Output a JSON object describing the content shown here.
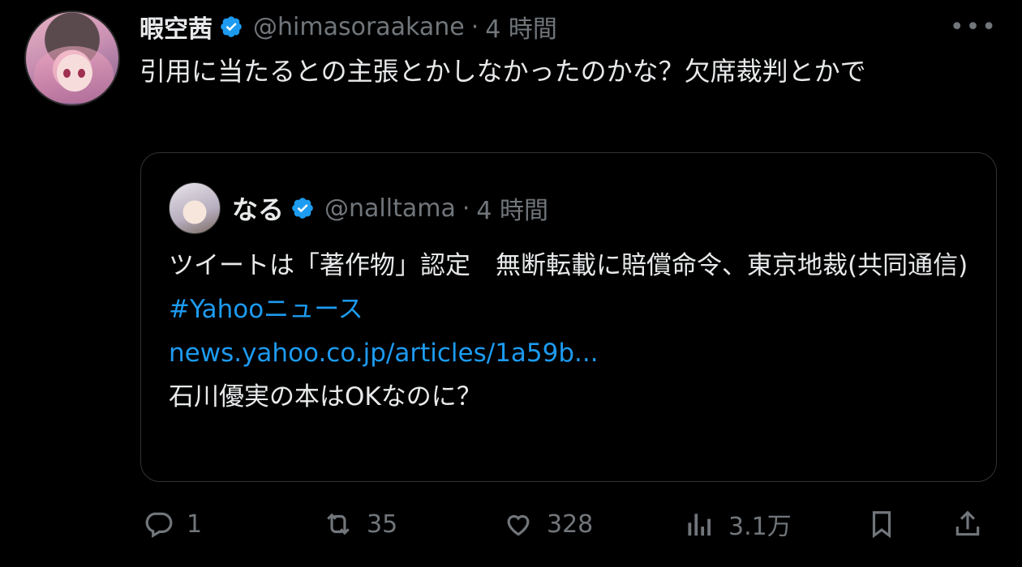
{
  "tweet": {
    "author_name": "暇空茜",
    "handle": "@himasoraakane",
    "separator": "·",
    "time": "4 時間",
    "text": "引用に当たるとの主張とかしなかったのかな？欠席裁判とかで"
  },
  "quote": {
    "author_name": "なる",
    "handle": "@nalltama",
    "separator": "·",
    "time": "4 時間",
    "line1": "ツイートは「著作物」認定　無断転載に賠償命令、東京地裁(共同通信)",
    "hashtag": "#Yahooニュース",
    "link": "news.yahoo.co.jp/articles/1a59b...",
    "line2": "石川優実の本はOKなのに？"
  },
  "actions": {
    "reply_count": "1",
    "retweet_count": "35",
    "like_count": "328",
    "view_count": "3.1万"
  },
  "icons": {
    "verified": "verified-badge-icon",
    "more": "more-options-icon",
    "reply": "reply-icon",
    "retweet": "retweet-icon",
    "like": "heart-icon",
    "views": "views-chart-icon",
    "bookmark": "bookmark-icon",
    "share": "share-icon"
  },
  "colors": {
    "background": "#000000",
    "text": "#e7e9ea",
    "muted": "#71767b",
    "link": "#1d9bf0",
    "verified": "#1d9bf0"
  }
}
